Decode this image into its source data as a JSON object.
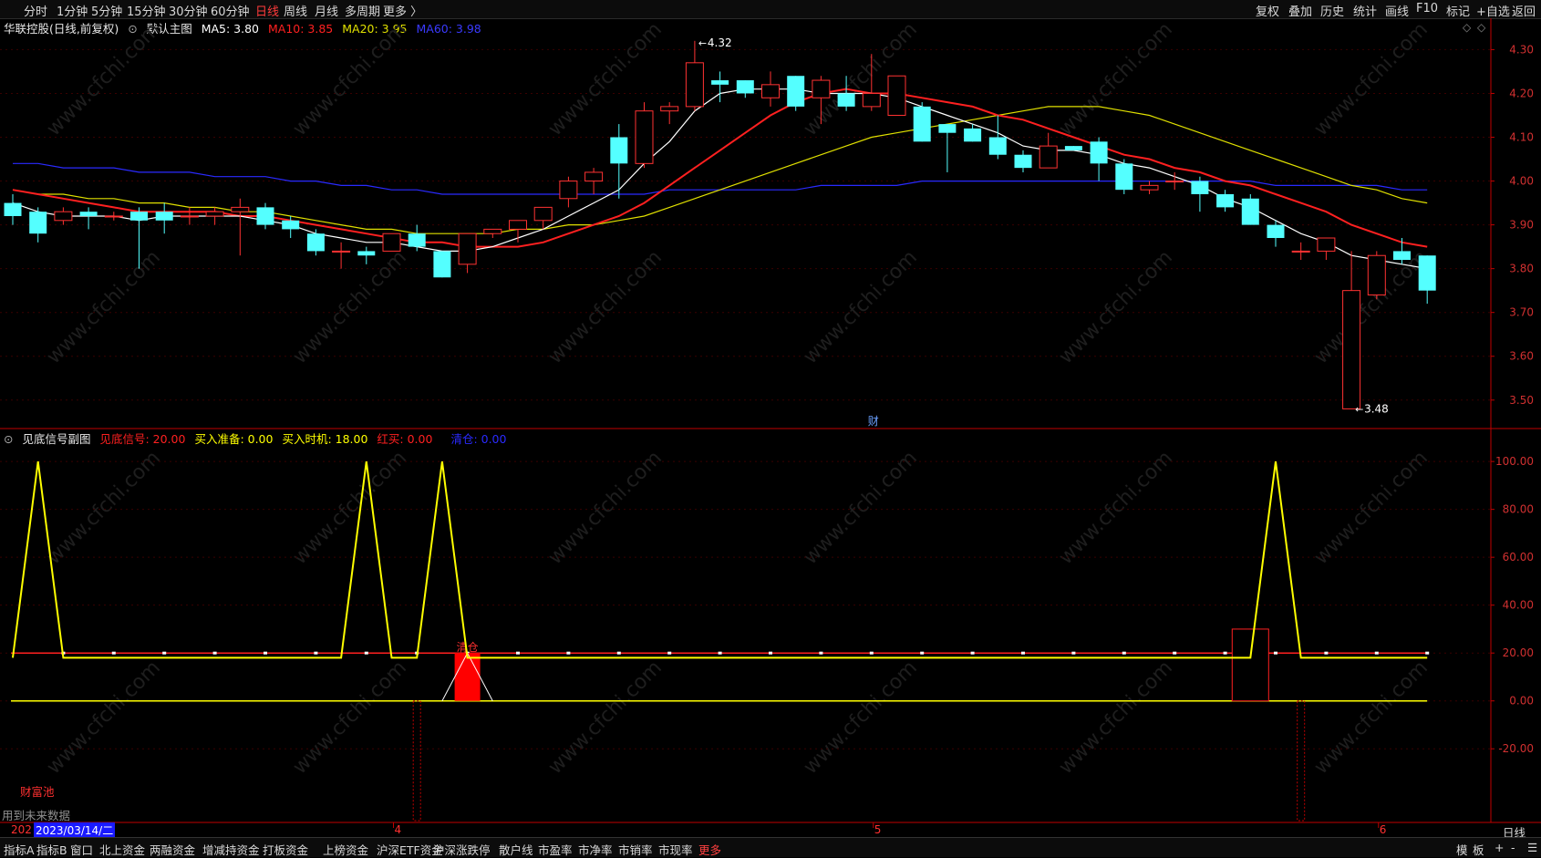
{
  "topbar": {
    "left_items": [
      "分时",
      "1分钟",
      "5分钟",
      "15分钟",
      "30分钟",
      "60分钟",
      "日线",
      "周线",
      "月线",
      "多周期",
      "更多 〉"
    ],
    "active_item": "日线",
    "right_items": [
      "复权",
      "叠加",
      "历史",
      "统计",
      "画线",
      "F10",
      "标记",
      "+自选",
      "返回"
    ]
  },
  "main_ribbon": {
    "stock": "华联控股(日线,前复权)",
    "chart_name": "默认主图",
    "ma5": "MA5: 3.80",
    "ma10": "MA10: 3.85",
    "ma20": "MA20: 3.95",
    "ma60": "MA60: 3.98"
  },
  "sub_ribbon": {
    "name": "见底信号副图",
    "s1": "见底信号: 20.00",
    "s2": "买入准备: 0.00",
    "s3": "买入时机: 18.00",
    "s4": "红买: 0.00",
    "s5": "清仓: 0.00"
  },
  "annotations": {
    "high_label": "4.32",
    "low_label": "3.48",
    "cai_marker": "财",
    "qingcang": "清仓",
    "caifu_chi": "财富池",
    "future_data": "用到未来数据",
    "watermark": "www.cfchi.com"
  },
  "datebar": {
    "year_stub": "202",
    "cursor_date": "2023/03/14/二",
    "month_ticks": [
      {
        "label": "4",
        "index": 15
      },
      {
        "label": "5",
        "index": 34
      },
      {
        "label": "6",
        "index": 54
      }
    ],
    "period_label": "日线"
  },
  "bottombar": {
    "tabs": [
      "指标A",
      "指标B",
      "窗口",
      "北上资金",
      "两融资金",
      "增减持资金",
      "打板资金",
      "上榜资金",
      "沪深ETF资金",
      "沪深涨跌停",
      "散户线",
      "市盈率",
      "市净率",
      "市销率",
      "市现率",
      "更多"
    ],
    "right_tabs": [
      "模",
      "板",
      "+",
      "-",
      "☰"
    ]
  },
  "colors": {
    "up": "#ff3232",
    "down": "#54ffff",
    "ma5": "#ffffff",
    "ma10": "#ff2020",
    "ma20": "#e0e000",
    "ma60": "#2a2aff",
    "axis_red": "#c00000",
    "yellow": "#ffff00"
  },
  "chart_data": [
    {
      "type": "candlestick",
      "title": "华联控股(日线,前复权)",
      "y_ticks": [
        4.3,
        4.2,
        4.1,
        4.0,
        3.9,
        3.8,
        3.7,
        3.6,
        3.5
      ],
      "ylim": [
        3.46,
        4.33
      ],
      "candles": [
        {
          "o": 3.95,
          "h": 3.97,
          "l": 3.9,
          "c": 3.92
        },
        {
          "o": 3.93,
          "h": 3.94,
          "l": 3.86,
          "c": 3.88
        },
        {
          "o": 3.91,
          "h": 3.94,
          "l": 3.9,
          "c": 3.93
        },
        {
          "o": 3.93,
          "h": 3.94,
          "l": 3.89,
          "c": 3.92
        },
        {
          "o": 3.92,
          "h": 3.93,
          "l": 3.91,
          "c": 3.92
        },
        {
          "o": 3.93,
          "h": 3.94,
          "l": 3.8,
          "c": 3.91
        },
        {
          "o": 3.93,
          "h": 3.95,
          "l": 3.88,
          "c": 3.91
        },
        {
          "o": 3.92,
          "h": 3.94,
          "l": 3.9,
          "c": 3.92
        },
        {
          "o": 3.92,
          "h": 3.94,
          "l": 3.9,
          "c": 3.93
        },
        {
          "o": 3.93,
          "h": 3.96,
          "l": 3.83,
          "c": 3.94
        },
        {
          "o": 3.94,
          "h": 3.95,
          "l": 3.89,
          "c": 3.9
        },
        {
          "o": 3.91,
          "h": 3.92,
          "l": 3.87,
          "c": 3.89
        },
        {
          "o": 3.88,
          "h": 3.89,
          "l": 3.83,
          "c": 3.84
        },
        {
          "o": 3.84,
          "h": 3.86,
          "l": 3.8,
          "c": 3.84
        },
        {
          "o": 3.84,
          "h": 3.85,
          "l": 3.81,
          "c": 3.83
        },
        {
          "o": 3.84,
          "h": 3.88,
          "l": 3.84,
          "c": 3.88
        },
        {
          "o": 3.88,
          "h": 3.9,
          "l": 3.84,
          "c": 3.85
        },
        {
          "o": 3.84,
          "h": 3.84,
          "l": 3.78,
          "c": 3.78
        },
        {
          "o": 3.81,
          "h": 3.88,
          "l": 3.79,
          "c": 3.88
        },
        {
          "o": 3.88,
          "h": 3.89,
          "l": 3.87,
          "c": 3.89
        },
        {
          "o": 3.89,
          "h": 3.91,
          "l": 3.86,
          "c": 3.91
        },
        {
          "o": 3.91,
          "h": 3.94,
          "l": 3.89,
          "c": 3.94
        },
        {
          "o": 3.96,
          "h": 4.01,
          "l": 3.94,
          "c": 4.0
        },
        {
          "o": 4.0,
          "h": 4.03,
          "l": 3.97,
          "c": 4.02
        },
        {
          "o": 4.1,
          "h": 4.13,
          "l": 3.96,
          "c": 4.04
        },
        {
          "o": 4.04,
          "h": 4.18,
          "l": 4.03,
          "c": 4.16
        },
        {
          "o": 4.16,
          "h": 4.18,
          "l": 4.13,
          "c": 4.17
        },
        {
          "o": 4.17,
          "h": 4.32,
          "l": 4.16,
          "c": 4.27
        },
        {
          "o": 4.23,
          "h": 4.25,
          "l": 4.18,
          "c": 4.22
        },
        {
          "o": 4.23,
          "h": 4.23,
          "l": 4.19,
          "c": 4.2
        },
        {
          "o": 4.19,
          "h": 4.25,
          "l": 4.17,
          "c": 4.22
        },
        {
          "o": 4.24,
          "h": 4.24,
          "l": 4.16,
          "c": 4.17
        },
        {
          "o": 4.19,
          "h": 4.24,
          "l": 4.13,
          "c": 4.23
        },
        {
          "o": 4.2,
          "h": 4.24,
          "l": 4.16,
          "c": 4.17
        },
        {
          "o": 4.17,
          "h": 4.29,
          "l": 4.16,
          "c": 4.2
        },
        {
          "o": 4.15,
          "h": 4.24,
          "l": 4.15,
          "c": 4.24
        },
        {
          "o": 4.17,
          "h": 4.18,
          "l": 4.09,
          "c": 4.09
        },
        {
          "o": 4.13,
          "h": 4.13,
          "l": 4.02,
          "c": 4.11
        },
        {
          "o": 4.12,
          "h": 4.13,
          "l": 4.09,
          "c": 4.09
        },
        {
          "o": 4.1,
          "h": 4.15,
          "l": 4.05,
          "c": 4.06
        },
        {
          "o": 4.06,
          "h": 4.07,
          "l": 4.02,
          "c": 4.03
        },
        {
          "o": 4.03,
          "h": 4.11,
          "l": 4.03,
          "c": 4.08
        },
        {
          "o": 4.08,
          "h": 4.08,
          "l": 4.07,
          "c": 4.07
        },
        {
          "o": 4.09,
          "h": 4.1,
          "l": 4.0,
          "c": 4.04
        },
        {
          "o": 4.04,
          "h": 4.05,
          "l": 3.97,
          "c": 3.98
        },
        {
          "o": 3.98,
          "h": 4.0,
          "l": 3.97,
          "c": 3.99
        },
        {
          "o": 4.0,
          "h": 4.02,
          "l": 3.98,
          "c": 4.0
        },
        {
          "o": 4.0,
          "h": 4.01,
          "l": 3.93,
          "c": 3.97
        },
        {
          "o": 3.97,
          "h": 3.98,
          "l": 3.93,
          "c": 3.94
        },
        {
          "o": 3.96,
          "h": 3.97,
          "l": 3.9,
          "c": 3.9
        },
        {
          "o": 3.9,
          "h": 3.91,
          "l": 3.85,
          "c": 3.87
        },
        {
          "o": 3.84,
          "h": 3.86,
          "l": 3.82,
          "c": 3.84
        },
        {
          "o": 3.84,
          "h": 3.87,
          "l": 3.82,
          "c": 3.87
        },
        {
          "o": 3.48,
          "h": 3.84,
          "l": 3.48,
          "c": 3.75
        },
        {
          "o": 3.74,
          "h": 3.84,
          "l": 3.73,
          "c": 3.83
        },
        {
          "o": 3.84,
          "h": 3.87,
          "l": 3.81,
          "c": 3.82
        },
        {
          "o": 3.83,
          "h": 3.83,
          "l": 3.72,
          "c": 3.75
        }
      ],
      "ma5": [
        3.95,
        3.93,
        3.92,
        3.92,
        3.92,
        3.91,
        3.92,
        3.92,
        3.92,
        3.92,
        3.91,
        3.9,
        3.88,
        3.87,
        3.86,
        3.86,
        3.85,
        3.84,
        3.84,
        3.85,
        3.87,
        3.89,
        3.92,
        3.95,
        3.98,
        4.04,
        4.09,
        4.16,
        4.2,
        4.21,
        4.21,
        4.21,
        4.2,
        4.2,
        4.2,
        4.19,
        4.17,
        4.15,
        4.13,
        4.11,
        4.08,
        4.07,
        4.07,
        4.06,
        4.04,
        4.03,
        4.01,
        3.99,
        3.96,
        3.94,
        3.91,
        3.88,
        3.86,
        3.83,
        3.82,
        3.81,
        3.8
      ],
      "ma10": [
        3.98,
        3.97,
        3.96,
        3.95,
        3.94,
        3.93,
        3.93,
        3.93,
        3.93,
        3.92,
        3.92,
        3.91,
        3.9,
        3.89,
        3.88,
        3.87,
        3.86,
        3.86,
        3.85,
        3.85,
        3.85,
        3.86,
        3.88,
        3.9,
        3.92,
        3.95,
        3.99,
        4.03,
        4.07,
        4.11,
        4.15,
        4.18,
        4.2,
        4.21,
        4.2,
        4.2,
        4.19,
        4.18,
        4.17,
        4.15,
        4.14,
        4.12,
        4.1,
        4.08,
        4.06,
        4.05,
        4.03,
        4.02,
        4.0,
        3.99,
        3.97,
        3.95,
        3.93,
        3.9,
        3.88,
        3.86,
        3.85
      ],
      "ma20": [
        3.98,
        3.97,
        3.97,
        3.96,
        3.96,
        3.95,
        3.95,
        3.94,
        3.94,
        3.93,
        3.93,
        3.92,
        3.91,
        3.9,
        3.89,
        3.89,
        3.88,
        3.88,
        3.88,
        3.88,
        3.89,
        3.89,
        3.9,
        3.9,
        3.91,
        3.92,
        3.94,
        3.96,
        3.98,
        4.0,
        4.02,
        4.04,
        4.06,
        4.08,
        4.1,
        4.11,
        4.12,
        4.13,
        4.14,
        4.15,
        4.16,
        4.17,
        4.17,
        4.17,
        4.16,
        4.15,
        4.13,
        4.11,
        4.09,
        4.07,
        4.05,
        4.03,
        4.01,
        3.99,
        3.98,
        3.96,
        3.95
      ],
      "ma60": [
        4.04,
        4.04,
        4.03,
        4.03,
        4.03,
        4.02,
        4.02,
        4.02,
        4.01,
        4.01,
        4.01,
        4.0,
        4.0,
        3.99,
        3.99,
        3.98,
        3.98,
        3.97,
        3.97,
        3.97,
        3.97,
        3.97,
        3.97,
        3.97,
        3.97,
        3.97,
        3.98,
        3.98,
        3.98,
        3.98,
        3.98,
        3.98,
        3.99,
        3.99,
        3.99,
        3.99,
        4.0,
        4.0,
        4.0,
        4.0,
        4.0,
        4.0,
        4.0,
        4.0,
        4.0,
        4.0,
        4.0,
        4.0,
        4.0,
        4.0,
        3.99,
        3.99,
        3.99,
        3.99,
        3.99,
        3.98,
        3.98
      ]
    },
    {
      "type": "line",
      "title": "见底信号副图",
      "y_ticks": [
        100,
        80,
        60,
        40,
        20,
        0,
        -20
      ],
      "ylim": [
        -50,
        105
      ],
      "bottom_signal_index": [
        1,
        14,
        17,
        50
      ],
      "bottom_signal_value": 100,
      "baseline_value": 18,
      "red_line_value": 20,
      "zero_value": 0,
      "buy_bar": {
        "index": 18,
        "value": 20
      },
      "black_box": {
        "index": 49,
        "value": 30
      },
      "dashed_down": [
        {
          "index": 16,
          "value": -50
        },
        {
          "index": 51,
          "value": -50
        }
      ]
    }
  ]
}
